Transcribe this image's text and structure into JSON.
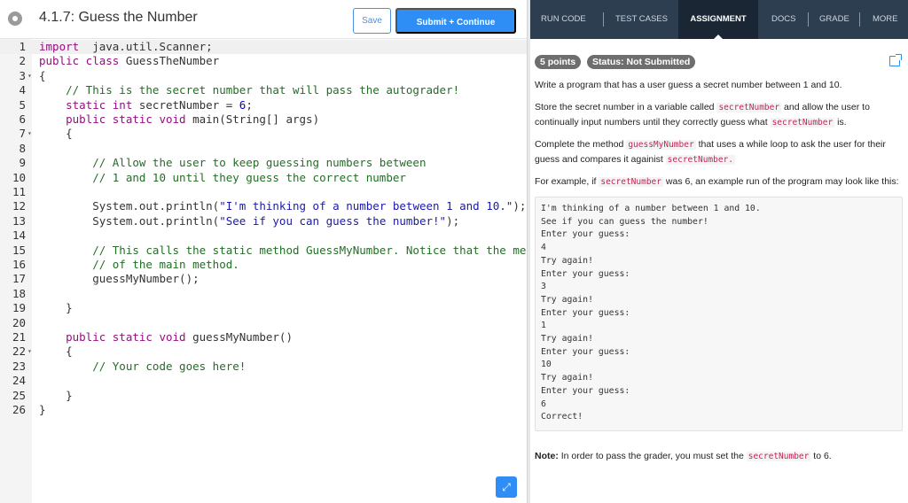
{
  "header": {
    "title": "4.1.7: Guess the Number",
    "save_label": "Save",
    "submit_label": "Submit + Continue"
  },
  "editor": {
    "lines": [
      {
        "n": "1",
        "fold": "",
        "parts": [
          [
            "kw",
            "import"
          ],
          [
            "",
            "  java.util.Scanner;"
          ]
        ]
      },
      {
        "n": "2",
        "fold": "",
        "parts": [
          [
            "kw",
            "public class"
          ],
          [
            "",
            " GuessTheNumber"
          ]
        ]
      },
      {
        "n": "3",
        "fold": "▾",
        "parts": [
          [
            "",
            "{"
          ]
        ]
      },
      {
        "n": "4",
        "fold": "",
        "parts": [
          [
            "cm",
            "    // This is the secret number that will pass the autograder!"
          ]
        ]
      },
      {
        "n": "5",
        "fold": "",
        "parts": [
          [
            "kw",
            "    static int"
          ],
          [
            "",
            " secretNumber = "
          ],
          [
            "num",
            "6"
          ],
          [
            "",
            ";"
          ]
        ]
      },
      {
        "n": "6",
        "fold": "",
        "parts": [
          [
            "kw",
            "    public static void"
          ],
          [
            "",
            " main(String[] args)"
          ]
        ]
      },
      {
        "n": "7",
        "fold": "▾",
        "parts": [
          [
            "",
            "    {"
          ]
        ]
      },
      {
        "n": "8",
        "fold": "",
        "parts": [
          [
            "",
            ""
          ]
        ]
      },
      {
        "n": "9",
        "fold": "",
        "parts": [
          [
            "cm",
            "        // Allow the user to keep guessing numbers between"
          ]
        ]
      },
      {
        "n": "10",
        "fold": "",
        "parts": [
          [
            "cm",
            "        // 1 and 10 until they guess the correct number"
          ]
        ]
      },
      {
        "n": "11",
        "fold": "",
        "parts": [
          [
            "",
            ""
          ]
        ]
      },
      {
        "n": "12",
        "fold": "",
        "parts": [
          [
            "",
            "        System.out.println("
          ],
          [
            "str",
            "\"I'm thinking of a number between 1 and 10.\""
          ],
          [
            "",
            ");"
          ]
        ]
      },
      {
        "n": "13",
        "fold": "",
        "parts": [
          [
            "",
            "        System.out.println("
          ],
          [
            "str",
            "\"See if you can guess the number!\""
          ],
          [
            "",
            ");"
          ]
        ]
      },
      {
        "n": "14",
        "fold": "",
        "parts": [
          [
            "",
            ""
          ]
        ]
      },
      {
        "n": "15",
        "fold": "",
        "parts": [
          [
            "cm",
            "        // This calls the static method GuessMyNumber. Notice that the metho"
          ]
        ]
      },
      {
        "n": "16",
        "fold": "",
        "parts": [
          [
            "cm",
            "        // of the main method."
          ]
        ]
      },
      {
        "n": "17",
        "fold": "",
        "parts": [
          [
            "",
            "        guessMyNumber();"
          ]
        ]
      },
      {
        "n": "18",
        "fold": "",
        "parts": [
          [
            "",
            ""
          ]
        ]
      },
      {
        "n": "19",
        "fold": "",
        "parts": [
          [
            "",
            "    }"
          ]
        ]
      },
      {
        "n": "20",
        "fold": "",
        "parts": [
          [
            "",
            ""
          ]
        ]
      },
      {
        "n": "21",
        "fold": "",
        "parts": [
          [
            "kw",
            "    public static void"
          ],
          [
            "",
            " guessMyNumber()"
          ]
        ]
      },
      {
        "n": "22",
        "fold": "▾",
        "parts": [
          [
            "",
            "    {"
          ]
        ]
      },
      {
        "n": "23",
        "fold": "",
        "parts": [
          [
            "cm",
            "        // Your code goes here!"
          ]
        ]
      },
      {
        "n": "24",
        "fold": "",
        "parts": [
          [
            "",
            ""
          ]
        ]
      },
      {
        "n": "25",
        "fold": "",
        "parts": [
          [
            "",
            "    }"
          ]
        ]
      },
      {
        "n": "26",
        "fold": "",
        "parts": [
          [
            "",
            "}"
          ]
        ]
      }
    ],
    "expand_icon": "expand-arrows-icon"
  },
  "tabs": {
    "items": [
      "RUN CODE",
      "TEST CASES",
      "ASSIGNMENT",
      "DOCS",
      "GRADE",
      "MORE"
    ],
    "active": "ASSIGNMENT"
  },
  "assignment": {
    "points": "5 points",
    "status": "Status: Not Submitted",
    "p1": "Write a program that has a user guess a secret number between 1 and 10.",
    "p2a": "Store the secret number in a variable called ",
    "p2b": " and allow the user to continually input numbers until they correctly guess what ",
    "p2c": " is.",
    "p3a": "Complete the method ",
    "p3b": " that uses a while loop to ask the user for their guess and compares it againist ",
    "p3c": ".",
    "p4a": "For example, if ",
    "p4b": " was 6, an example run of the program may look like this:",
    "code_secret": "secretNumber",
    "code_secret_dot": "secretNumber.",
    "code_guess": "guessMyNumber",
    "sample_output": "I'm thinking of a number between 1 and 10.\nSee if you can guess the number!\nEnter your guess:\n4\nTry again!\nEnter your guess:\n3\nTry again!\nEnter your guess:\n1\nTry again!\nEnter your guess:\n10\nTry again!\nEnter your guess:\n6\nCorrect!",
    "note_label": "Note:",
    "note_text": " In order to pass the grader, you must set the ",
    "note_end": " to 6."
  },
  "colors": {
    "accent": "#2e8ef5",
    "tabbar": "#2c3e50",
    "inline_code": "#c7254e"
  }
}
